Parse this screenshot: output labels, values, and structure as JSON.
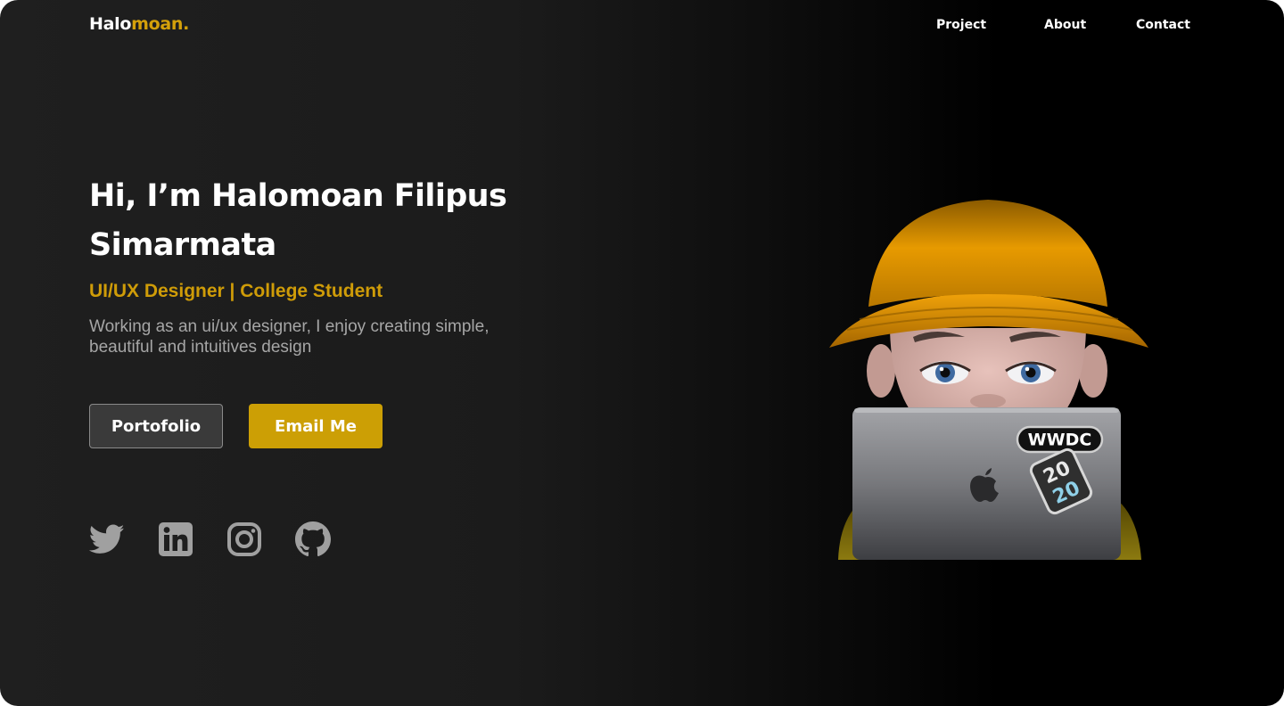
{
  "brand": {
    "logo_part1": "Halo",
    "logo_part2": "moan."
  },
  "nav": {
    "project": "Project",
    "about": "About",
    "contact": "Contact"
  },
  "hero": {
    "headline": "Hi, I’m Halomoan Filipus Simarmata",
    "role": "UI/UX Designer | College Student",
    "description": "Working as an ui/ux designer,  I enjoy creating simple, beautiful and intuitives design"
  },
  "buttons": {
    "portfolio": "Portofolio",
    "email": "Email Me"
  },
  "social": [
    "twitter-icon",
    "linkedin-icon",
    "instagram-icon",
    "github-icon"
  ],
  "illustration": {
    "sticker_wwdc": "WWDC",
    "sticker_year_top": "20",
    "sticker_year_bottom": "20"
  },
  "colors": {
    "accent": "#cc9f05",
    "background": "#1f1f1f",
    "text_muted": "#a6a6a6",
    "icon": "#a0a0a0"
  }
}
